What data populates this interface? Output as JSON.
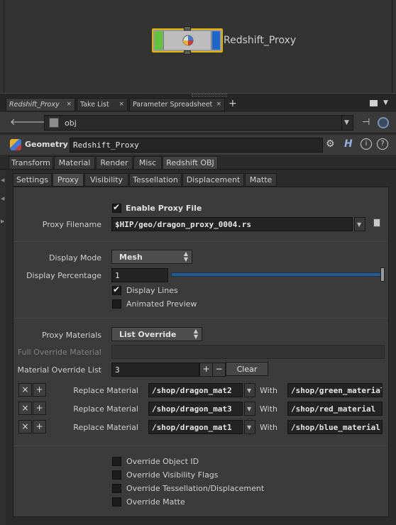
{
  "network": {
    "node_label": "Redshift_Proxy"
  },
  "pane_tabs": [
    {
      "label": "Redshift_Proxy"
    },
    {
      "label": "Take List"
    },
    {
      "label": "Parameter Spreadsheet"
    }
  ],
  "pane_tab_close": "×",
  "pane_tab_add": "+",
  "path": {
    "value": "obj"
  },
  "operator": {
    "type": "Geometry",
    "name": "Redshift_Proxy"
  },
  "folder_tabs": [
    "Transform",
    "Material",
    "Render",
    "Misc",
    "Redshift OBJ"
  ],
  "sub_tabs": [
    "Settings",
    "Proxy",
    "Visibility",
    "Tessellation",
    "Displacement",
    "Matte"
  ],
  "proxy": {
    "enable_label": "Enable Proxy File",
    "enable_checked": true,
    "filename_label": "Proxy Filename",
    "filename_value": "$HIP/geo/dragon_proxy_0004.rs",
    "display_mode_label": "Display Mode",
    "display_mode_value": "Mesh",
    "display_pct_label": "Display Percentage",
    "display_pct_value": "1",
    "display_lines_label": "Display Lines",
    "display_lines_checked": true,
    "animated_preview_label": "Animated Preview",
    "animated_preview_checked": false,
    "materials_label": "Proxy Materials",
    "materials_value": "List Override",
    "full_override_label": "Full Override Material",
    "full_override_value": "",
    "override_list_label": "Material Override List",
    "override_list_value": "3",
    "clear_label": "Clear",
    "replace_label": "Replace Material",
    "with_label": "With",
    "overrides": [
      {
        "from": "/shop/dragon_mat2",
        "to": "/shop/green_material"
      },
      {
        "from": "/shop/dragon_mat3",
        "to": "/shop/red_material"
      },
      {
        "from": "/shop/dragon_mat1",
        "to": "/shop/blue_material"
      }
    ],
    "toggles": [
      {
        "label": "Override Object ID",
        "checked": false
      },
      {
        "label": "Override Visibility Flags",
        "checked": false
      },
      {
        "label": "Override Tessellation/Displacement",
        "checked": false
      },
      {
        "label": "Override Matte",
        "checked": false
      }
    ]
  }
}
